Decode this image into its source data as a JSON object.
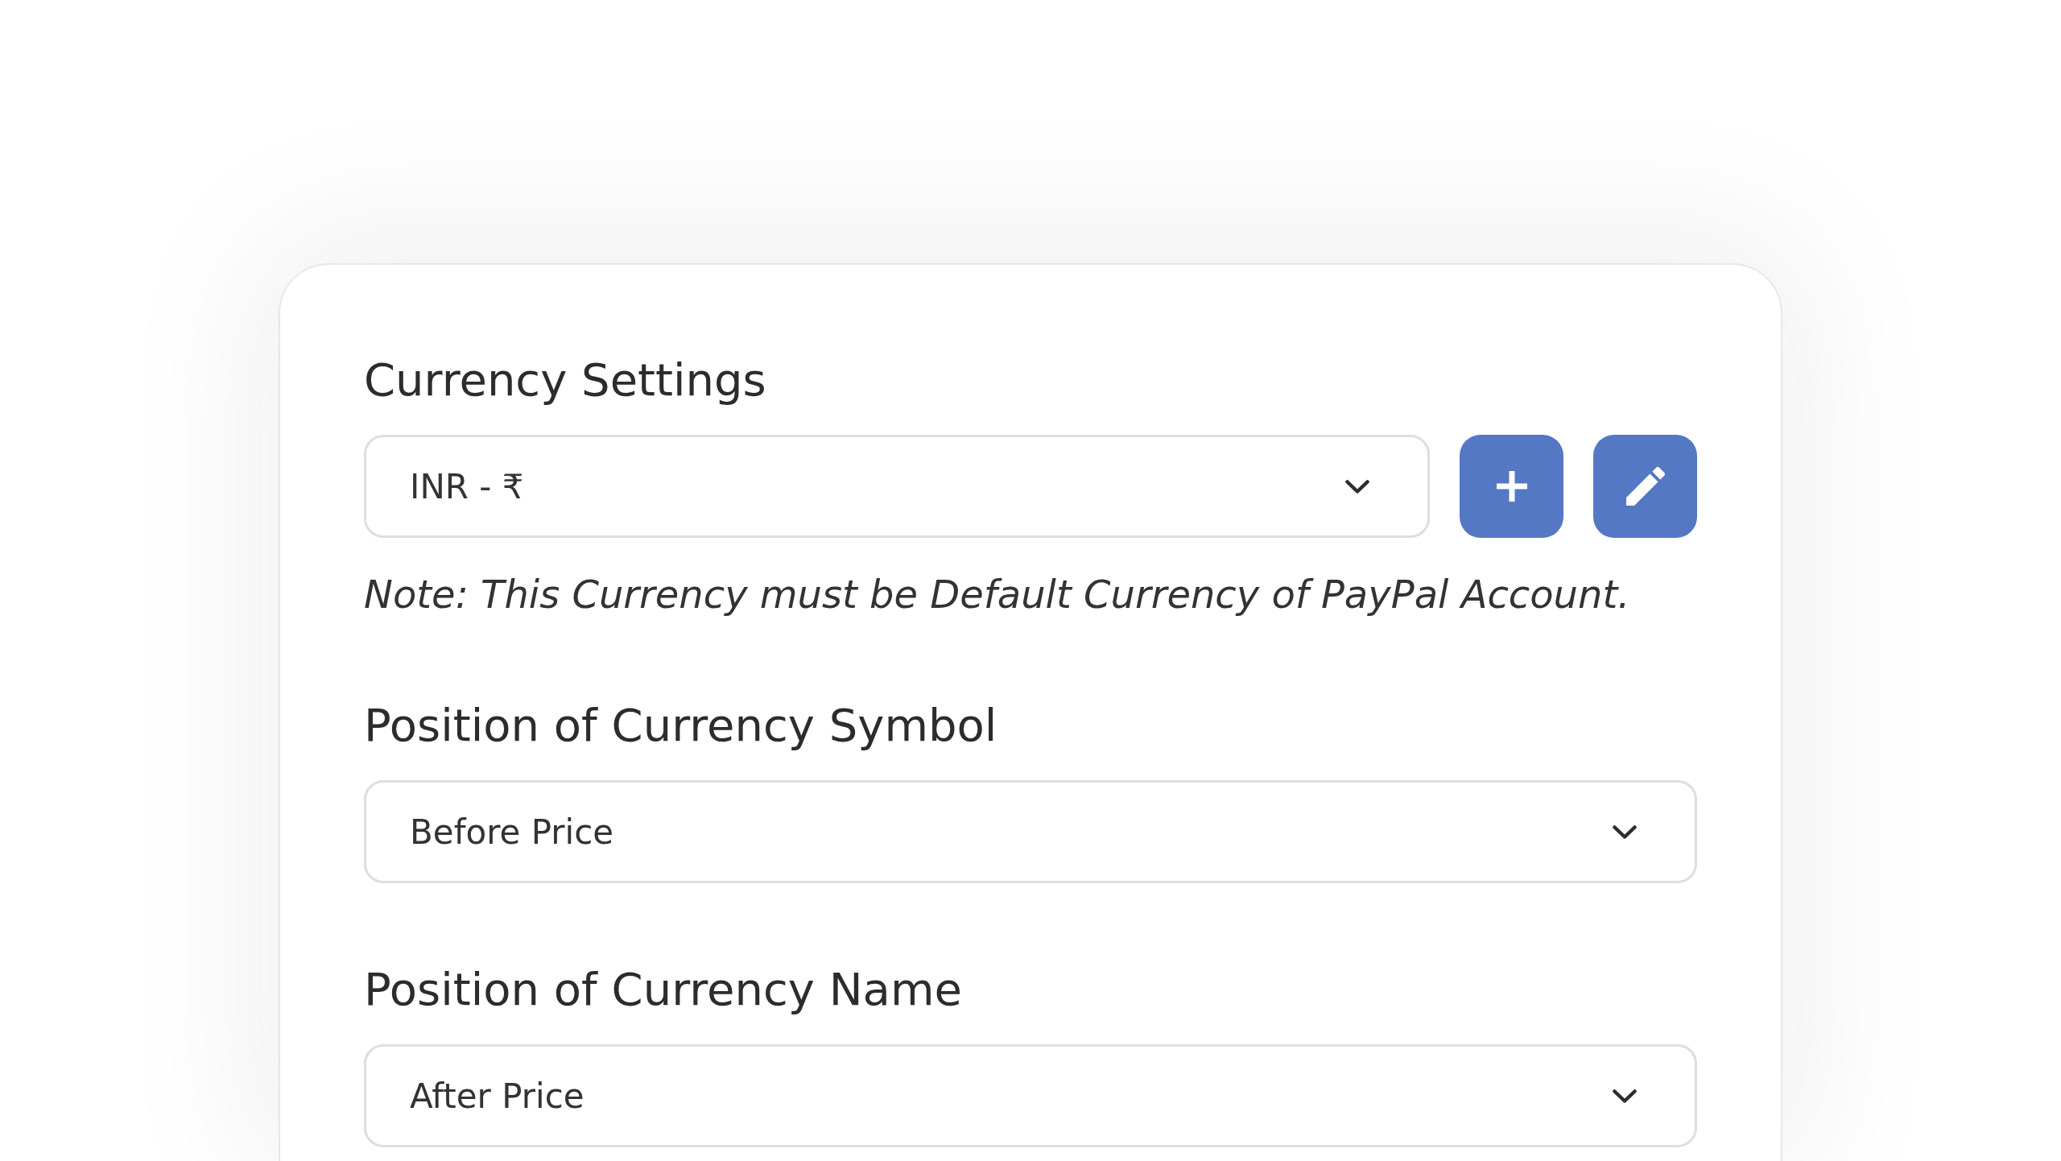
{
  "currency_settings": {
    "title": "Currency Settings",
    "currency_select": {
      "value": "INR - ₹"
    },
    "note": "Note: This Currency must be Default Currency of PayPal Account."
  },
  "symbol_position": {
    "title": "Position of Currency Symbol",
    "select": {
      "value": "Before Price"
    }
  },
  "name_position": {
    "title": "Position of Currency Name",
    "select": {
      "value": "After Price"
    }
  }
}
